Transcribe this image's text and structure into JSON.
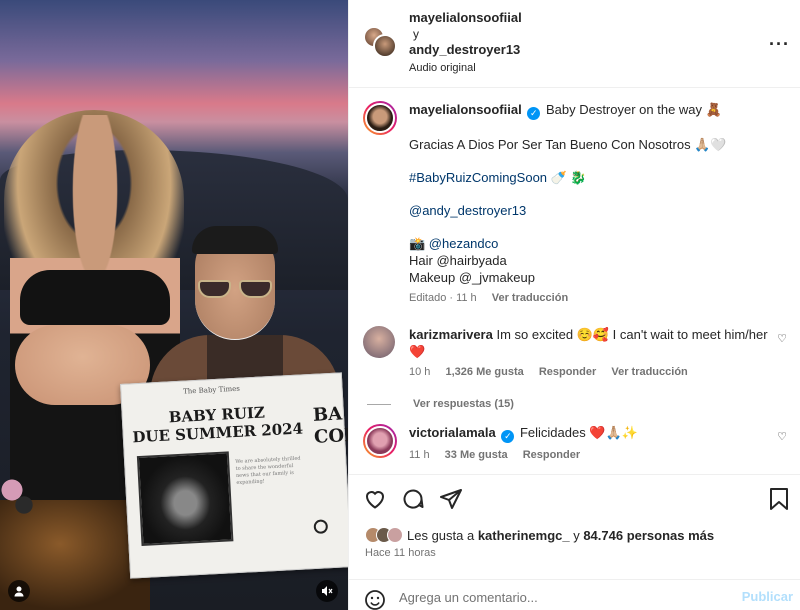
{
  "post": {
    "header": {
      "author1": "mayelialonsoofiial",
      "connector": "y",
      "author2": "andy_destroyer13",
      "audio": "Audio original",
      "more_icon": "more-dots-icon"
    },
    "photo": {
      "newspaper": {
        "masthead": "The Baby Times",
        "headline": "BABY RUIZ\nDUE SUMMER 2024",
        "headline_right": "BA\nCOI",
        "body_text": "We are absolutely thrilled to share the wonderful news that our family is expanding!"
      }
    },
    "caption": {
      "username": "mayelialonsoofiial",
      "lines": [
        "Baby Destroyer on the way 🧸",
        "Gracias A Dios Por Ser Tan Bueno Con Nosotros 🙏🏼🤍",
        "#BabyRuizComingSoon 🍼 🐉",
        "@andy_destroyer13",
        "📸 @hezandco",
        "Hair @hairbyada",
        "Makeup @_jvmakeup"
      ],
      "edited": "Editado · 11 h",
      "translate": "Ver traducción"
    },
    "comments": [
      {
        "username": "karizmarivera",
        "text": "Im so excited ☺️🥰 I can't wait to meet him/her ❤️",
        "time": "10 h",
        "likes": "1,326 Me gusta",
        "reply": "Responder",
        "translate": "Ver traducción",
        "view_replies": "Ver respuestas (15)"
      },
      {
        "username": "victorialamala",
        "text": "Felicidades ❤️🙏🏼✨",
        "time": "11 h",
        "likes": "33 Me gusta",
        "reply": "Responder"
      }
    ],
    "likes": {
      "prefix": "Les gusta a ",
      "user": "katherinemgc_",
      "middle": " y ",
      "count": "84.746 personas más"
    },
    "posted": "Hace 11 horas",
    "comment_box": {
      "placeholder": "Agrega un comentario...",
      "publish": "Publicar"
    }
  }
}
